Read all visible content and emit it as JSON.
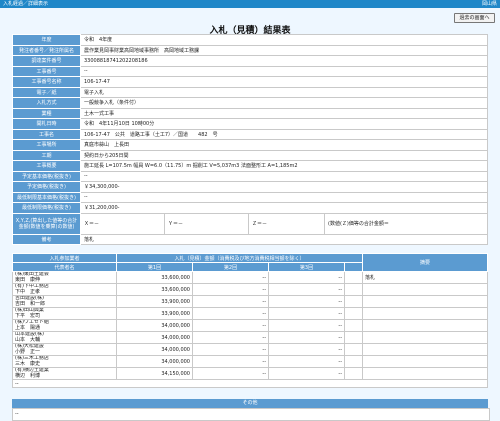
{
  "header": {
    "left": "入札経過／詳細表示",
    "right": "岡山県"
  },
  "back_button": "過去の画面へ",
  "title": "入札（見積）結果表",
  "details": [
    {
      "label": "年度",
      "value": "令和　4年度"
    },
    {
      "label": "発注者番号／発注所属名",
      "value": "農作業見岡事財業高岡地域事務所　高岡地域工務課"
    },
    {
      "label": "調達案件番号",
      "value": "33008818741202208186"
    },
    {
      "label": "工事番号",
      "value": "--"
    },
    {
      "label": "工事番号名称",
      "value": "106-17-47"
    },
    {
      "label": "電子／紙",
      "value": "電子入札"
    },
    {
      "label": "入札方式",
      "value": "一般競争入札（条件付）"
    },
    {
      "label": "業種",
      "value": "土木一式工事"
    },
    {
      "label": "開札日時",
      "value": "令和　4年11月10日 10時00分"
    },
    {
      "label": "工事名",
      "value": "106-17-47　公共　道路工事（土工7）／国道　　482　号"
    },
    {
      "label": "工事場所",
      "value": "真庭市蒜山　上長田"
    },
    {
      "label": "工期",
      "value": "契約日から205日間"
    },
    {
      "label": "工事概要",
      "value": "施工延長 L=107.5m 幅員 W=6.0（11.75）m 掘削工 V=5,037m3 法面整形工 A=1,185m2"
    },
    {
      "label": "予定基本価格(税抜き)",
      "value": "--"
    },
    {
      "label": "予定価格(税抜き)",
      "value": "￥34,300,000-"
    },
    {
      "label": "最低制限基本価格(税抜き)",
      "value": "--"
    },
    {
      "label": "最低制限価格(税抜き)",
      "value": "￥31,200,000-"
    }
  ],
  "calc_row": {
    "label": "X,Y,Z,(算出した値等の合計金額(数値を乗算)の数値)",
    "x": "Ｘ＝－",
    "y": "Ｙ＝－",
    "z": "Ｚ＝－",
    "total": "(数値(Ｚ)価等の合計金額＝"
  },
  "remark_row": {
    "label": "備考",
    "value": "落札"
  },
  "bidders_table": {
    "col_company": "入札参加業者",
    "col_rep": "代表者名",
    "col_amount_group": "入札（見積）金額（消費税及び地方消費税相当額を除く）",
    "col_round1": "第1回",
    "col_round2": "第2回",
    "col_round3": "第3回",
    "col_note": "摘要",
    "rows": [
      {
        "company": "(株)東田土建会",
        "rep": "東田　康伸",
        "r1": "33,600,000",
        "r2": "--",
        "r3": "--",
        "note": "落札"
      },
      {
        "company": "(有)下中工務店",
        "rep": "下中　正孝",
        "r1": "33,600,000",
        "r2": "--",
        "r3": "--",
        "note": ""
      },
      {
        "company": "吉田建設(株)",
        "rep": "吉田　和一郎",
        "r1": "33,900,000",
        "r2": "--",
        "r3": "--",
        "note": ""
      },
      {
        "company": "(株)田山興業",
        "rep": "下平　宏司",
        "r1": "33,900,000",
        "r2": "--",
        "r3": "--",
        "note": ""
      },
      {
        "company": "(株)ウエセト組",
        "rep": "上本　陽通",
        "r1": "34,000,000",
        "r2": "--",
        "r3": "--",
        "note": ""
      },
      {
        "company": "山本建設(株)",
        "rep": "山本　大輔",
        "r1": "34,000,000",
        "r2": "--",
        "r3": "--",
        "note": ""
      },
      {
        "company": "(株)大松建設",
        "rep": "小野　正一",
        "r1": "34,000,000",
        "r2": "--",
        "r3": "--",
        "note": ""
      },
      {
        "company": "(株)三木工務店",
        "rep": "三木　康史",
        "r1": "34,000,000",
        "r2": "--",
        "r3": "--",
        "note": ""
      },
      {
        "company": "(有)横辺土建業",
        "rep": "横辺　利博",
        "r1": "34,150,000",
        "r2": "--",
        "r3": "--",
        "note": ""
      }
    ],
    "footer": "--"
  },
  "other": {
    "heading": "その他",
    "value": "--"
  }
}
